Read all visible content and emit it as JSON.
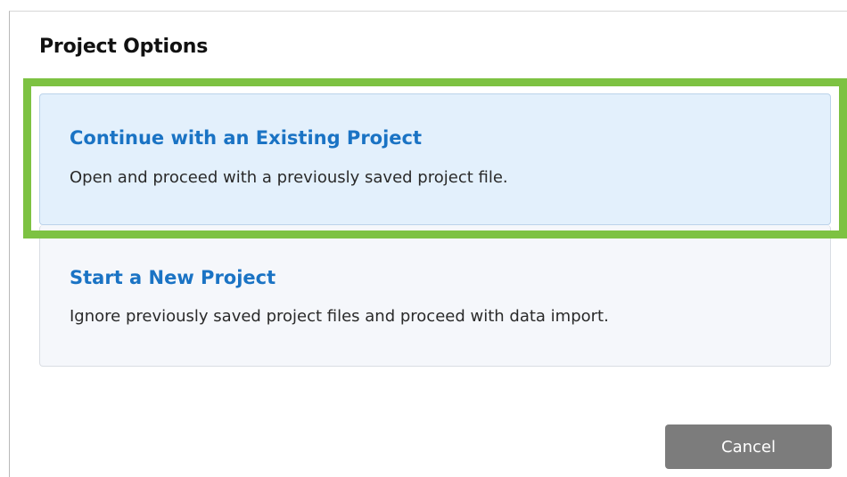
{
  "dialog": {
    "title": "Project Options",
    "options": [
      {
        "title": "Continue with an Existing Project",
        "description": "Open and proceed with a previously saved project file.",
        "selected": true
      },
      {
        "title": "Start a New Project",
        "description": "Ignore previously saved project files and proceed with data import.",
        "selected": false
      }
    ],
    "cancel_label": "Cancel"
  },
  "colors": {
    "option_title": "#1a73c4",
    "selected_background": "#e3f0fc",
    "highlight_frame": "#7dc242",
    "cancel_button": "#7c7c7c"
  }
}
